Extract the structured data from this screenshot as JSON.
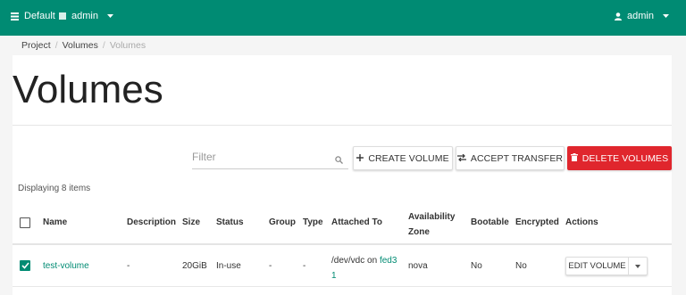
{
  "topbar": {
    "project_label": "Default",
    "domain_label": "admin",
    "user_label": "admin",
    "icons": [
      "project-icon",
      "domain-icon",
      "user-icon",
      "caret-down-icon"
    ]
  },
  "breadcrumb": {
    "items": [
      "Project",
      "Volumes",
      "Volumes"
    ],
    "separator": "/"
  },
  "page": {
    "title": "Volumes"
  },
  "toolbar": {
    "filter_placeholder": "Filter",
    "create_label": "CREATE VOLUME",
    "accept_label": "ACCEPT TRANSFER",
    "delete_label": "DELETE VOLUMES",
    "danger_color": "#e0262d"
  },
  "table": {
    "displaying": "Displaying 8 items",
    "columns": [
      "Name",
      "Description",
      "Size",
      "Status",
      "Group",
      "Type",
      "Attached To",
      "Availability Zone",
      "Bootable",
      "Encrypted",
      "Actions"
    ],
    "availability_line1": "Availability",
    "availability_line2": "Zone",
    "rows": [
      {
        "checked": true,
        "name": "test-volume",
        "description": "-",
        "size": "20GiB",
        "status": "In-use",
        "group": "-",
        "type": "-",
        "attached_prefix": "/dev/vdc on",
        "attached_host_part1": "fed3",
        "attached_host_part2": "1",
        "availability_zone": "nova",
        "bootable": "No",
        "encrypted": "No",
        "action_label": "EDIT VOLUME"
      }
    ]
  },
  "colors": {
    "brand": "#008b73",
    "link": "#008b73"
  }
}
